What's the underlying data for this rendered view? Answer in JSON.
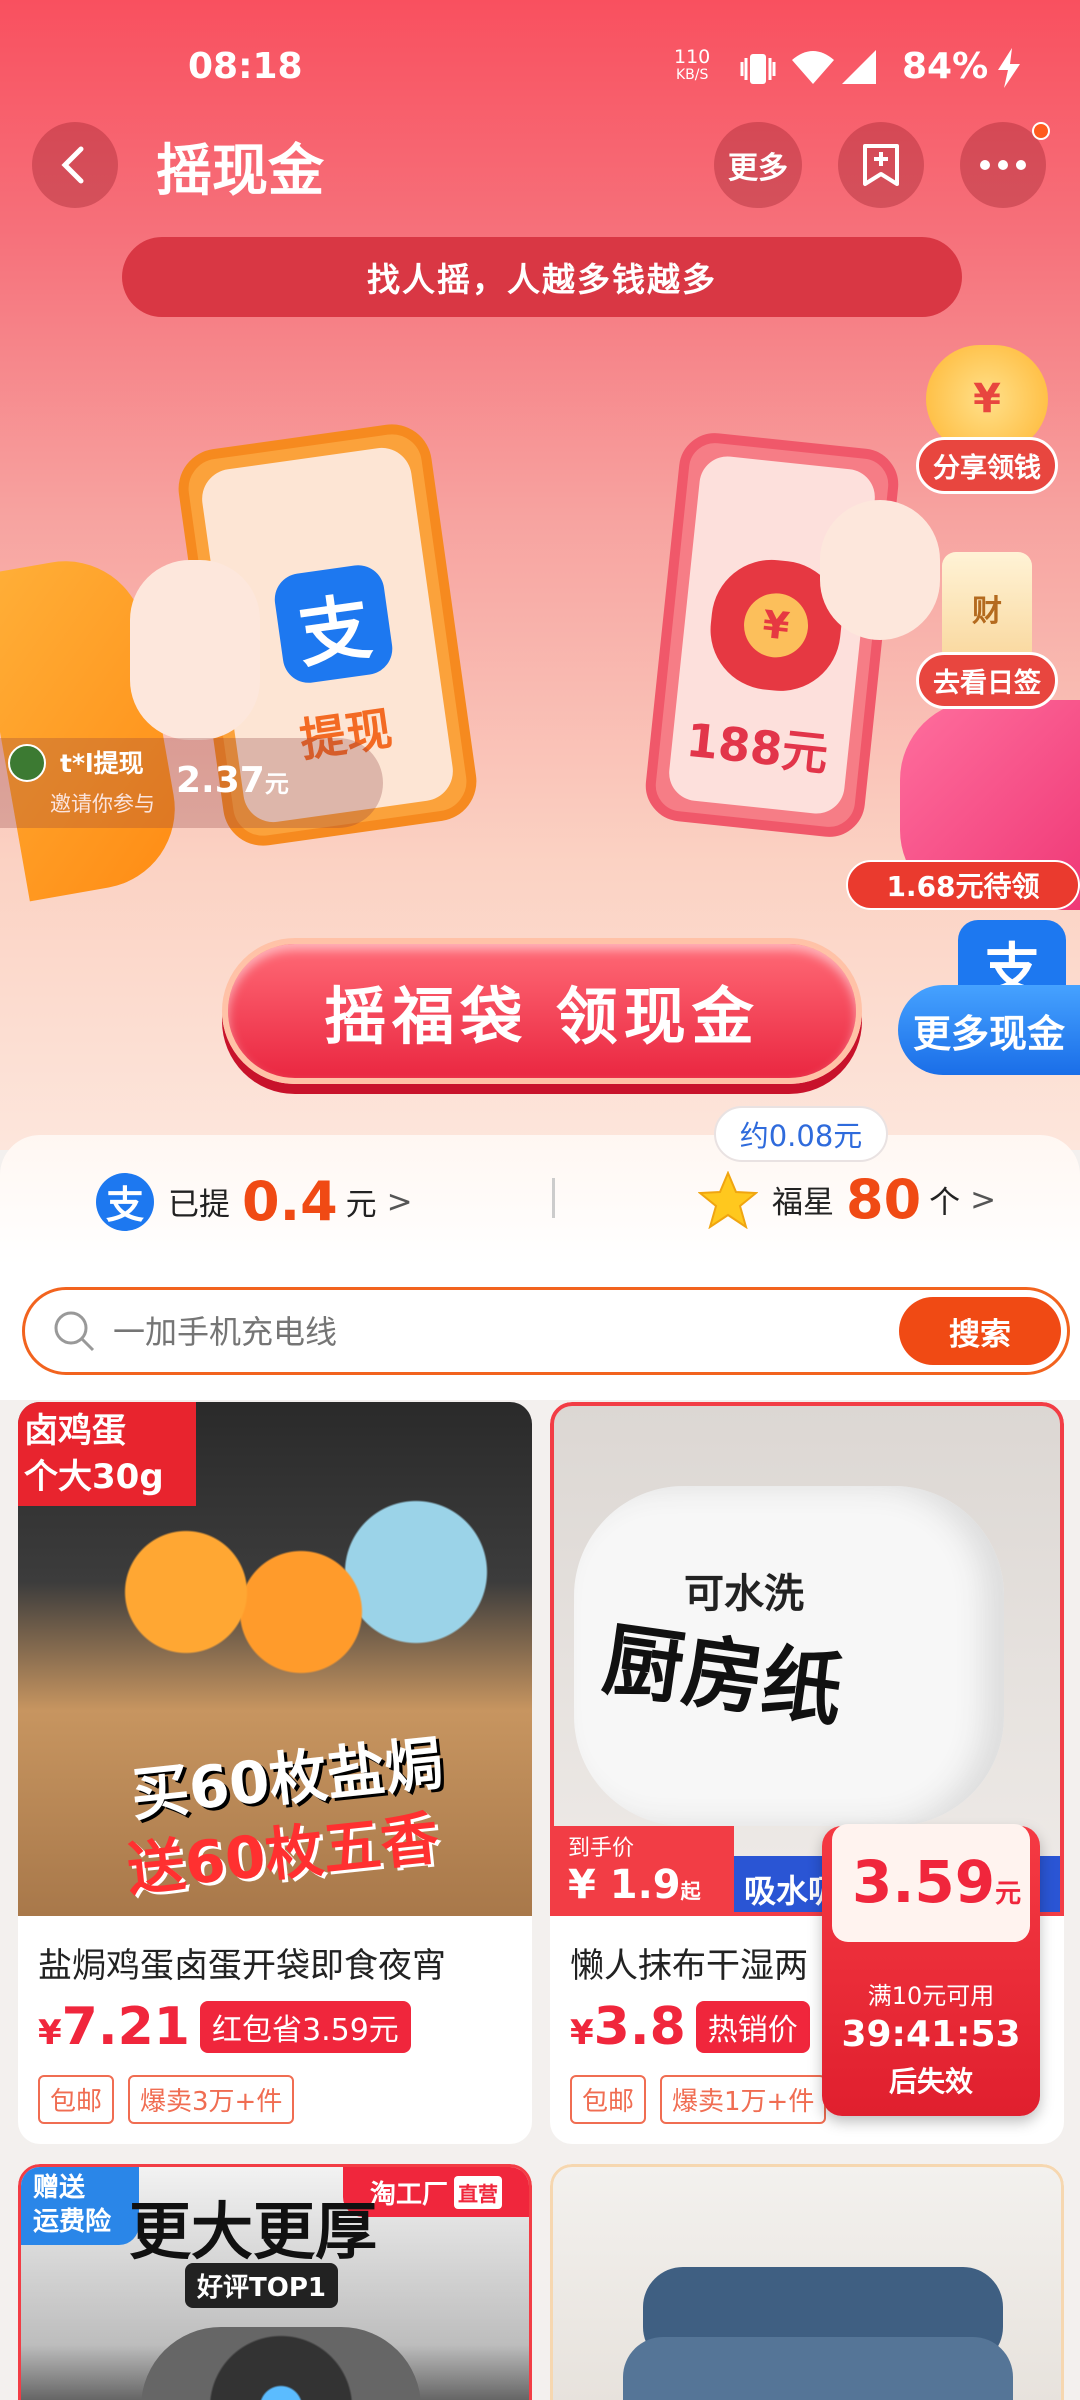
{
  "status_bar": {
    "time": "08:18",
    "net_speed_value": "110",
    "net_speed_unit": "KB/S",
    "battery": "84%"
  },
  "header": {
    "title": "摇现金",
    "more_label": "更多"
  },
  "banner": {
    "text": "找人摇，人越多钱越多"
  },
  "side_widgets": {
    "share": "分享领钱",
    "checkin": "去看日签",
    "more_cash_pending": "1.68元待领",
    "more_cash": "更多现金",
    "coin_symbol": "¥",
    "tag_char": "财"
  },
  "phones": {
    "left_label": "提现",
    "right_amount": "188元",
    "alipay_glyph": "支",
    "bag_symbol": "¥"
  },
  "ticker": {
    "user": "t*l提现",
    "sub": "邀请你参与",
    "amount": "2.37",
    "unit": "元"
  },
  "cta": {
    "label": "摇福袋 领现金"
  },
  "stats": {
    "approx": "约0.08元",
    "withdrawn_label": "已提",
    "withdrawn_value": "0.4",
    "withdrawn_unit": "元",
    "star_label": "福星",
    "star_value": "80",
    "star_unit": "个",
    "chevron": ">"
  },
  "search": {
    "placeholder": "一加手机充电线",
    "button": "搜索"
  },
  "products": [
    {
      "corner_tag_line1": "卤鸡蛋",
      "corner_tag_line2": "个大30g",
      "img_text1": "买60枚盐焗",
      "img_text2": "送60枚五香",
      "title": "盐焗鸡蛋卤蛋开袋即食夜宵",
      "currency": "¥",
      "price": "7.21",
      "tag": "红包省3.59元",
      "badges": [
        "包邮",
        "爆卖3万+件"
      ]
    },
    {
      "img_text_small": "可水洗",
      "img_text_big": "厨房纸",
      "bottom_label": "到手价",
      "bottom_price": "¥ 1.9",
      "bottom_suffix": "起",
      "stripe_text": "吸水吸",
      "title": "懒人抹布干湿两",
      "currency": "¥",
      "price": "3.8",
      "tag": "热销价",
      "badges": [
        "包邮",
        "爆卖1万+件"
      ]
    },
    {
      "corner_tag_line1": "赠送",
      "corner_tag_line2": "运费险",
      "img_text": "更大更厚",
      "factory": "淘工厂",
      "direct": "直营",
      "review": "好评TOP1"
    },
    {}
  ],
  "coupon": {
    "amount": "3.59",
    "unit": "元",
    "condition": "满10元可用",
    "countdown": "39:41:53",
    "expire": "后失效"
  },
  "colors": {
    "accent": "#f0263c",
    "orange": "#f04a14",
    "hero_top": "#f9505f"
  }
}
